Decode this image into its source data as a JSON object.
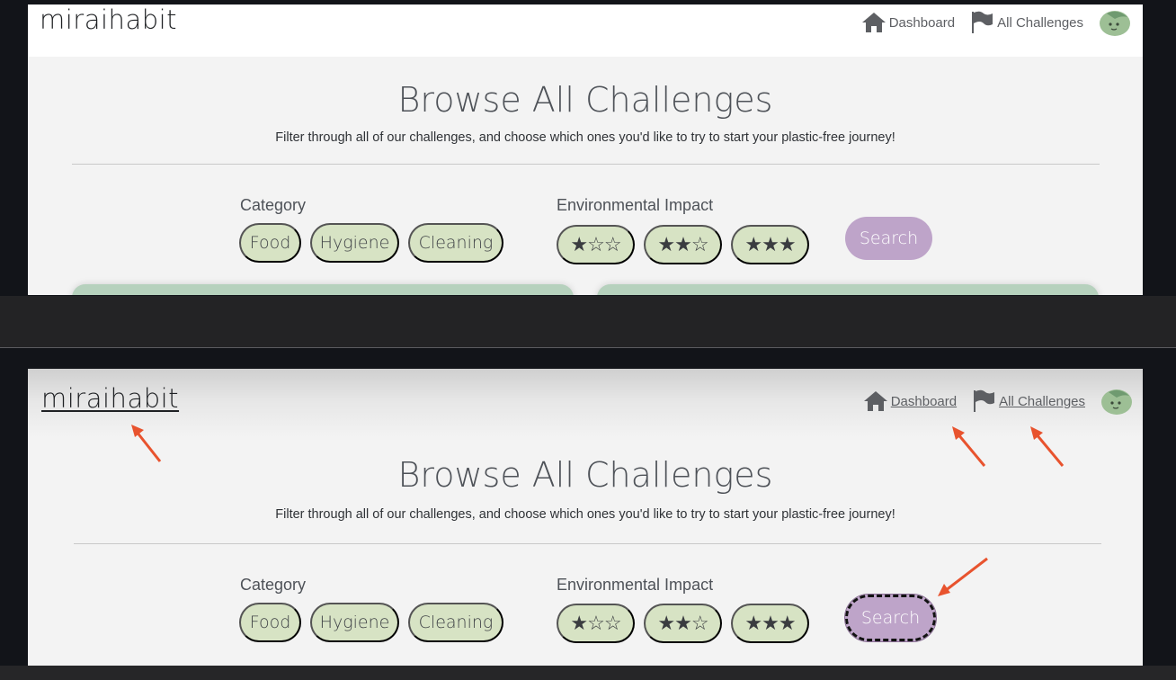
{
  "app": {
    "logo": "miraihabit",
    "nav": [
      {
        "label": "Dashboard",
        "icon": "home-icon"
      },
      {
        "label": "All Challenges",
        "icon": "flag-icon"
      }
    ],
    "avatar_icon": "leaf-mascot-icon"
  },
  "page": {
    "title": "Browse All Challenges",
    "subtitle": "Filter through all of our challenges, and choose which ones you'd like to try to start your plastic-free journey!"
  },
  "filters": {
    "category_label": "Category",
    "categories": [
      "Food",
      "Hygiene",
      "Cleaning"
    ],
    "impact_label": "Environmental Impact",
    "impact_levels": [
      "★☆☆",
      "★★☆",
      "★★★"
    ],
    "search_label": "Search"
  },
  "colors": {
    "pill": "#d7e3c4",
    "search_button": "#bea4c9",
    "card": "#b6d1bd",
    "annotation_arrow": "#e8532e"
  }
}
